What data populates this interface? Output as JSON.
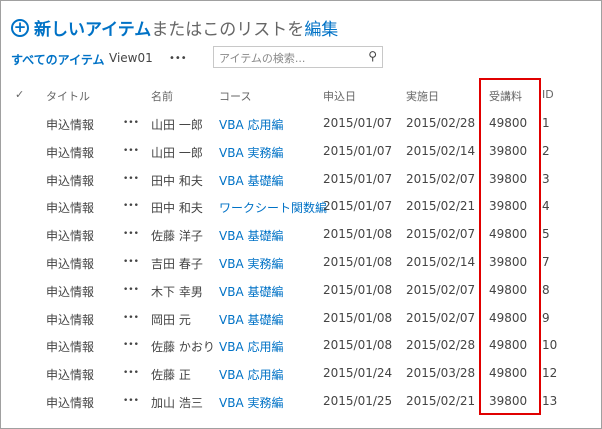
{
  "header": {
    "new_item": "新しいアイテム",
    "middle": "またはこのリストを",
    "edit": "編集"
  },
  "nav": {
    "all_items": "すべてのアイテム",
    "view01": "View01",
    "more": "•••"
  },
  "search": {
    "placeholder": "アイテムの検索..."
  },
  "columns": {
    "check": "✓",
    "title": "タイトル",
    "name": "名前",
    "course": "コース",
    "apply_date": "申込日",
    "exec_date": "実施日",
    "fee": "受講料",
    "id": "ID"
  },
  "rows": [
    {
      "title": "申込情報",
      "name": "山田 一郎",
      "course": "VBA 応用編",
      "apply": "2015/01/07",
      "exec": "2015/02/28",
      "fee": "49800",
      "id": "1"
    },
    {
      "title": "申込情報",
      "name": "山田 一郎",
      "course": "VBA 実務編",
      "apply": "2015/01/07",
      "exec": "2015/02/14",
      "fee": "39800",
      "id": "2"
    },
    {
      "title": "申込情報",
      "name": "田中 和夫",
      "course": "VBA 基礎編",
      "apply": "2015/01/07",
      "exec": "2015/02/07",
      "fee": "39800",
      "id": "3"
    },
    {
      "title": "申込情報",
      "name": "田中 和夫",
      "course": "ワークシート関数編",
      "apply": "2015/01/07",
      "exec": "2015/02/21",
      "fee": "39800",
      "id": "4"
    },
    {
      "title": "申込情報",
      "name": "佐藤 洋子",
      "course": "VBA 基礎編",
      "apply": "2015/01/08",
      "exec": "2015/02/07",
      "fee": "49800",
      "id": "5"
    },
    {
      "title": "申込情報",
      "name": "吉田 春子",
      "course": "VBA 実務編",
      "apply": "2015/01/08",
      "exec": "2015/02/14",
      "fee": "39800",
      "id": "7"
    },
    {
      "title": "申込情報",
      "name": "木下 幸男",
      "course": "VBA 基礎編",
      "apply": "2015/01/08",
      "exec": "2015/02/07",
      "fee": "49800",
      "id": "8"
    },
    {
      "title": "申込情報",
      "name": "岡田 元",
      "course": "VBA 基礎編",
      "apply": "2015/01/08",
      "exec": "2015/02/07",
      "fee": "49800",
      "id": "9"
    },
    {
      "title": "申込情報",
      "name": "佐藤 かおり",
      "course": "VBA 応用編",
      "apply": "2015/01/08",
      "exec": "2015/02/28",
      "fee": "49800",
      "id": "10"
    },
    {
      "title": "申込情報",
      "name": "佐藤 正",
      "course": "VBA 応用編",
      "apply": "2015/01/24",
      "exec": "2015/03/28",
      "fee": "49800",
      "id": "12"
    },
    {
      "title": "申込情報",
      "name": "加山 浩三",
      "course": "VBA 実務編",
      "apply": "2015/01/25",
      "exec": "2015/02/21",
      "fee": "39800",
      "id": "13"
    }
  ],
  "row_menu": "•••",
  "colors": {
    "accent": "#0072c6",
    "highlight": "#e00000"
  }
}
